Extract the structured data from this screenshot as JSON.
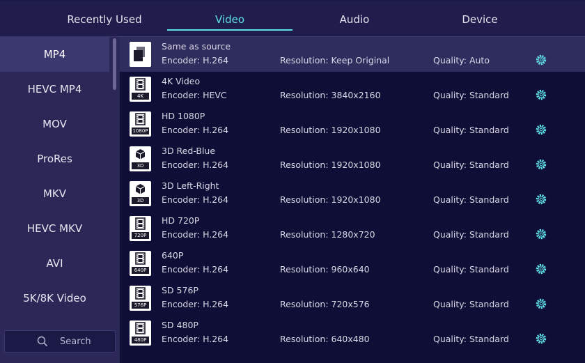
{
  "tabs": [
    {
      "label": "Recently Used",
      "active": false
    },
    {
      "label": "Video",
      "active": true
    },
    {
      "label": "Audio",
      "active": false
    },
    {
      "label": "Device",
      "active": false
    }
  ],
  "sidebar": {
    "items": [
      {
        "label": "MP4",
        "active": true
      },
      {
        "label": "HEVC MP4",
        "active": false
      },
      {
        "label": "MOV",
        "active": false
      },
      {
        "label": "ProRes",
        "active": false
      },
      {
        "label": "MKV",
        "active": false
      },
      {
        "label": "HEVC MKV",
        "active": false
      },
      {
        "label": "AVI",
        "active": false
      },
      {
        "label": "5K/8K Video",
        "active": false
      }
    ],
    "search_label": "Search"
  },
  "presets": [
    {
      "name": "Same as source",
      "encoder": "Encoder: H.264",
      "resolution": "Resolution: Keep Original",
      "quality": "Quality: Auto",
      "badge": "",
      "icon": "copy-icon",
      "selected": true
    },
    {
      "name": "4K Video",
      "encoder": "Encoder: HEVC",
      "resolution": "Resolution: 3840x2160",
      "quality": "Quality: Standard",
      "badge": "4K",
      "icon": "film-icon",
      "selected": false
    },
    {
      "name": "HD 1080P",
      "encoder": "Encoder: H.264",
      "resolution": "Resolution: 1920x1080",
      "quality": "Quality: Standard",
      "badge": "1080P",
      "icon": "film-icon",
      "selected": false
    },
    {
      "name": "3D Red-Blue",
      "encoder": "Encoder: H.264",
      "resolution": "Resolution: 1920x1080",
      "quality": "Quality: Standard",
      "badge": "3D",
      "icon": "cube-icon",
      "selected": false
    },
    {
      "name": "3D Left-Right",
      "encoder": "Encoder: H.264",
      "resolution": "Resolution: 1920x1080",
      "quality": "Quality: Standard",
      "badge": "3D",
      "icon": "cube-icon",
      "selected": false
    },
    {
      "name": "HD 720P",
      "encoder": "Encoder: H.264",
      "resolution": "Resolution: 1280x720",
      "quality": "Quality: Standard",
      "badge": "720P",
      "icon": "film-icon",
      "selected": false
    },
    {
      "name": "640P",
      "encoder": "Encoder: H.264",
      "resolution": "Resolution: 960x640",
      "quality": "Quality: Standard",
      "badge": "640P",
      "icon": "film-icon",
      "selected": false
    },
    {
      "name": "SD 576P",
      "encoder": "Encoder: H.264",
      "resolution": "Resolution: 720x576",
      "quality": "Quality: Standard",
      "badge": "576P",
      "icon": "film-icon",
      "selected": false
    },
    {
      "name": "SD 480P",
      "encoder": "Encoder: H.264",
      "resolution": "Resolution: 640x480",
      "quality": "Quality: Standard",
      "badge": "480P",
      "icon": "film-icon",
      "selected": false
    }
  ],
  "colors": {
    "accent": "#5ee0e6",
    "background": "#0f0e36",
    "sidebar": "#2b2858",
    "selected_row": "#2f2c5e"
  }
}
